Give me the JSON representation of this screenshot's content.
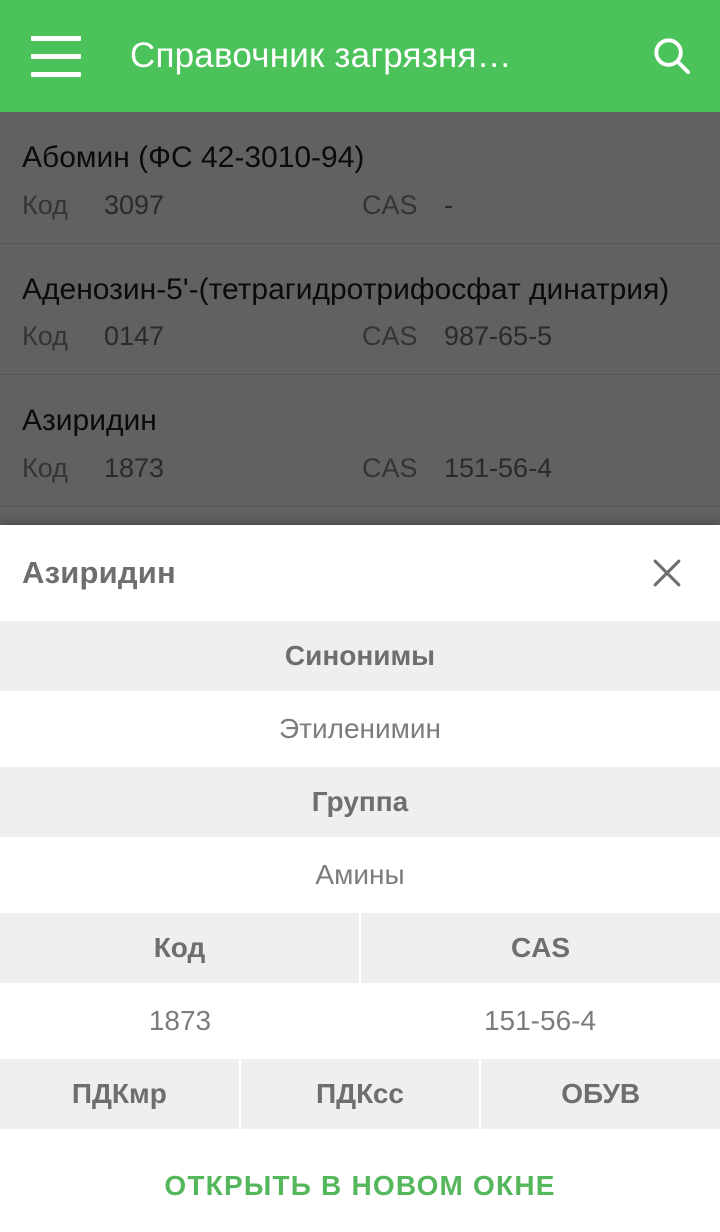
{
  "appbar": {
    "title": "Справочник загрязня…",
    "menu_icon": "hamburger-menu-icon",
    "search_icon": "search-icon",
    "background_color": "#4CC35A",
    "text_color": "#FFFFFF"
  },
  "list": {
    "items": [
      {
        "title": "Абомин (ФС 42-3010-94)",
        "code_label": "Код",
        "code_value": "3097",
        "cas_label": "CAS",
        "cas_value": "-"
      },
      {
        "title": "Аденозин-5'-(тетрагидротрифосфат динатрия)",
        "code_label": "Код",
        "code_value": "0147",
        "cas_label": "CAS",
        "cas_value": "987-65-5"
      },
      {
        "title": "Азиридин",
        "code_label": "Код",
        "code_value": "1873",
        "cas_label": "CAS",
        "cas_value": "151-56-4"
      }
    ]
  },
  "dialog": {
    "title": "Азиридин",
    "close_icon": "close-icon",
    "sections": {
      "synonyms_header": "Синонимы",
      "synonyms_value": "Этиленимин",
      "group_header": "Группа",
      "group_value": "Амины",
      "code_header": "Код",
      "cas_header": "CAS",
      "code_value": "1873",
      "cas_value": "151-56-4",
      "pdkmr_header": "ПДКмр",
      "pdkss_header": "ПДКсс",
      "obuv_header": "ОБУВ",
      "pdkmr_value": "",
      "pdkss_value": "",
      "obuv_value": ""
    },
    "footer": {
      "open_new_window_label": "ОТКРЫТЬ В НОВОМ ОКНЕ",
      "accent_color": "#55B75C"
    }
  }
}
